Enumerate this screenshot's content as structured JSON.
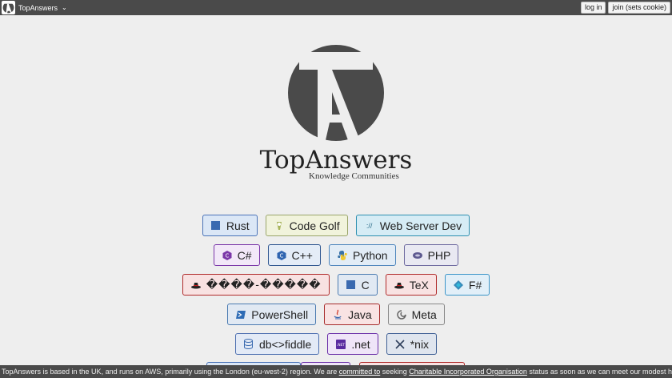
{
  "topbar": {
    "site_name": "TopAnswers",
    "login_label": "log in",
    "join_label": "join (sets cookie)"
  },
  "brand": {
    "title": "TopAnswers",
    "subtitle": "Knowledge Communities"
  },
  "communities": [
    [
      {
        "label": "Rust",
        "icon": "rust-icon",
        "color": "#4a73b8"
      },
      {
        "label": "Code Golf",
        "icon": "code-golf-icon",
        "color": "#9aa56a"
      },
      {
        "label": "Web Server Dev",
        "icon": "web-server-icon",
        "color": "#2e8fb0"
      }
    ],
    [
      {
        "label": "C#",
        "icon": "csharp-icon",
        "color": "#7a36a8"
      },
      {
        "label": "C++",
        "icon": "cpp-icon",
        "color": "#2f5690"
      },
      {
        "label": "Python",
        "icon": "python-icon",
        "color": "#4f86bd"
      },
      {
        "label": "PHP",
        "icon": "php-icon",
        "color": "#6e6aa0"
      }
    ],
    [
      {
        "label": "����-�����",
        "icon": "hat-icon",
        "color": "#b02a2a"
      },
      {
        "label": "C",
        "icon": "c-icon",
        "color": "#4b7bb1"
      },
      {
        "label": "TeX",
        "icon": "tex-icon",
        "color": "#b02a2a"
      },
      {
        "label": "F#",
        "icon": "fsharp-icon",
        "color": "#3a94c8"
      }
    ],
    [
      {
        "label": "PowerShell",
        "icon": "powershell-icon",
        "color": "#4b7bb1"
      },
      {
        "label": "Java",
        "icon": "java-icon",
        "color": "#a72c2c"
      },
      {
        "label": "Meta",
        "icon": "meta-icon",
        "color": "#888888"
      }
    ],
    [
      {
        "label": "db<>fiddle",
        "icon": "database-icon",
        "color": "#4d6fb0"
      },
      {
        "label": ".net",
        "icon": "dotnet-icon",
        "color": "#6a2fa8"
      },
      {
        "label": "*nix",
        "icon": "x-icon",
        "color": "#3e5f94"
      }
    ]
  ],
  "footer": {
    "text_1": "TopAnswers is based in the UK, and runs on AWS, primarily using the London (eu-west-2) region. We are ",
    "link_1": "committed to",
    "text_2": " seeking ",
    "link_2": "Charitable Incorporated Organisation",
    "text_3": " status as soon as we can meet our modest hosting and accounting"
  }
}
